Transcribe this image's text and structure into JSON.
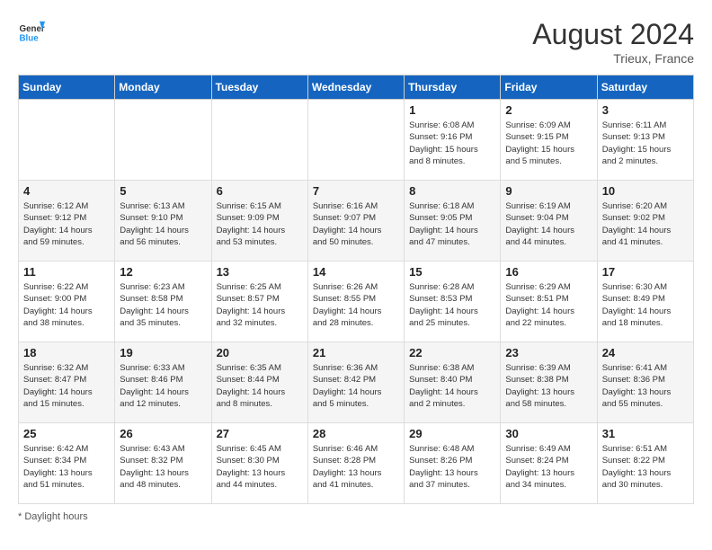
{
  "header": {
    "logo_line1": "General",
    "logo_line2": "Blue",
    "month_title": "August 2024",
    "location": "Trieux, France"
  },
  "days_of_week": [
    "Sunday",
    "Monday",
    "Tuesday",
    "Wednesday",
    "Thursday",
    "Friday",
    "Saturday"
  ],
  "footer": {
    "note": "Daylight hours"
  },
  "weeks": [
    [
      {
        "day": "",
        "info": ""
      },
      {
        "day": "",
        "info": ""
      },
      {
        "day": "",
        "info": ""
      },
      {
        "day": "",
        "info": ""
      },
      {
        "day": "1",
        "info": "Sunrise: 6:08 AM\nSunset: 9:16 PM\nDaylight: 15 hours\nand 8 minutes."
      },
      {
        "day": "2",
        "info": "Sunrise: 6:09 AM\nSunset: 9:15 PM\nDaylight: 15 hours\nand 5 minutes."
      },
      {
        "day": "3",
        "info": "Sunrise: 6:11 AM\nSunset: 9:13 PM\nDaylight: 15 hours\nand 2 minutes."
      }
    ],
    [
      {
        "day": "4",
        "info": "Sunrise: 6:12 AM\nSunset: 9:12 PM\nDaylight: 14 hours\nand 59 minutes."
      },
      {
        "day": "5",
        "info": "Sunrise: 6:13 AM\nSunset: 9:10 PM\nDaylight: 14 hours\nand 56 minutes."
      },
      {
        "day": "6",
        "info": "Sunrise: 6:15 AM\nSunset: 9:09 PM\nDaylight: 14 hours\nand 53 minutes."
      },
      {
        "day": "7",
        "info": "Sunrise: 6:16 AM\nSunset: 9:07 PM\nDaylight: 14 hours\nand 50 minutes."
      },
      {
        "day": "8",
        "info": "Sunrise: 6:18 AM\nSunset: 9:05 PM\nDaylight: 14 hours\nand 47 minutes."
      },
      {
        "day": "9",
        "info": "Sunrise: 6:19 AM\nSunset: 9:04 PM\nDaylight: 14 hours\nand 44 minutes."
      },
      {
        "day": "10",
        "info": "Sunrise: 6:20 AM\nSunset: 9:02 PM\nDaylight: 14 hours\nand 41 minutes."
      }
    ],
    [
      {
        "day": "11",
        "info": "Sunrise: 6:22 AM\nSunset: 9:00 PM\nDaylight: 14 hours\nand 38 minutes."
      },
      {
        "day": "12",
        "info": "Sunrise: 6:23 AM\nSunset: 8:58 PM\nDaylight: 14 hours\nand 35 minutes."
      },
      {
        "day": "13",
        "info": "Sunrise: 6:25 AM\nSunset: 8:57 PM\nDaylight: 14 hours\nand 32 minutes."
      },
      {
        "day": "14",
        "info": "Sunrise: 6:26 AM\nSunset: 8:55 PM\nDaylight: 14 hours\nand 28 minutes."
      },
      {
        "day": "15",
        "info": "Sunrise: 6:28 AM\nSunset: 8:53 PM\nDaylight: 14 hours\nand 25 minutes."
      },
      {
        "day": "16",
        "info": "Sunrise: 6:29 AM\nSunset: 8:51 PM\nDaylight: 14 hours\nand 22 minutes."
      },
      {
        "day": "17",
        "info": "Sunrise: 6:30 AM\nSunset: 8:49 PM\nDaylight: 14 hours\nand 18 minutes."
      }
    ],
    [
      {
        "day": "18",
        "info": "Sunrise: 6:32 AM\nSunset: 8:47 PM\nDaylight: 14 hours\nand 15 minutes."
      },
      {
        "day": "19",
        "info": "Sunrise: 6:33 AM\nSunset: 8:46 PM\nDaylight: 14 hours\nand 12 minutes."
      },
      {
        "day": "20",
        "info": "Sunrise: 6:35 AM\nSunset: 8:44 PM\nDaylight: 14 hours\nand 8 minutes."
      },
      {
        "day": "21",
        "info": "Sunrise: 6:36 AM\nSunset: 8:42 PM\nDaylight: 14 hours\nand 5 minutes."
      },
      {
        "day": "22",
        "info": "Sunrise: 6:38 AM\nSunset: 8:40 PM\nDaylight: 14 hours\nand 2 minutes."
      },
      {
        "day": "23",
        "info": "Sunrise: 6:39 AM\nSunset: 8:38 PM\nDaylight: 13 hours\nand 58 minutes."
      },
      {
        "day": "24",
        "info": "Sunrise: 6:41 AM\nSunset: 8:36 PM\nDaylight: 13 hours\nand 55 minutes."
      }
    ],
    [
      {
        "day": "25",
        "info": "Sunrise: 6:42 AM\nSunset: 8:34 PM\nDaylight: 13 hours\nand 51 minutes."
      },
      {
        "day": "26",
        "info": "Sunrise: 6:43 AM\nSunset: 8:32 PM\nDaylight: 13 hours\nand 48 minutes."
      },
      {
        "day": "27",
        "info": "Sunrise: 6:45 AM\nSunset: 8:30 PM\nDaylight: 13 hours\nand 44 minutes."
      },
      {
        "day": "28",
        "info": "Sunrise: 6:46 AM\nSunset: 8:28 PM\nDaylight: 13 hours\nand 41 minutes."
      },
      {
        "day": "29",
        "info": "Sunrise: 6:48 AM\nSunset: 8:26 PM\nDaylight: 13 hours\nand 37 minutes."
      },
      {
        "day": "30",
        "info": "Sunrise: 6:49 AM\nSunset: 8:24 PM\nDaylight: 13 hours\nand 34 minutes."
      },
      {
        "day": "31",
        "info": "Sunrise: 6:51 AM\nSunset: 8:22 PM\nDaylight: 13 hours\nand 30 minutes."
      }
    ]
  ]
}
